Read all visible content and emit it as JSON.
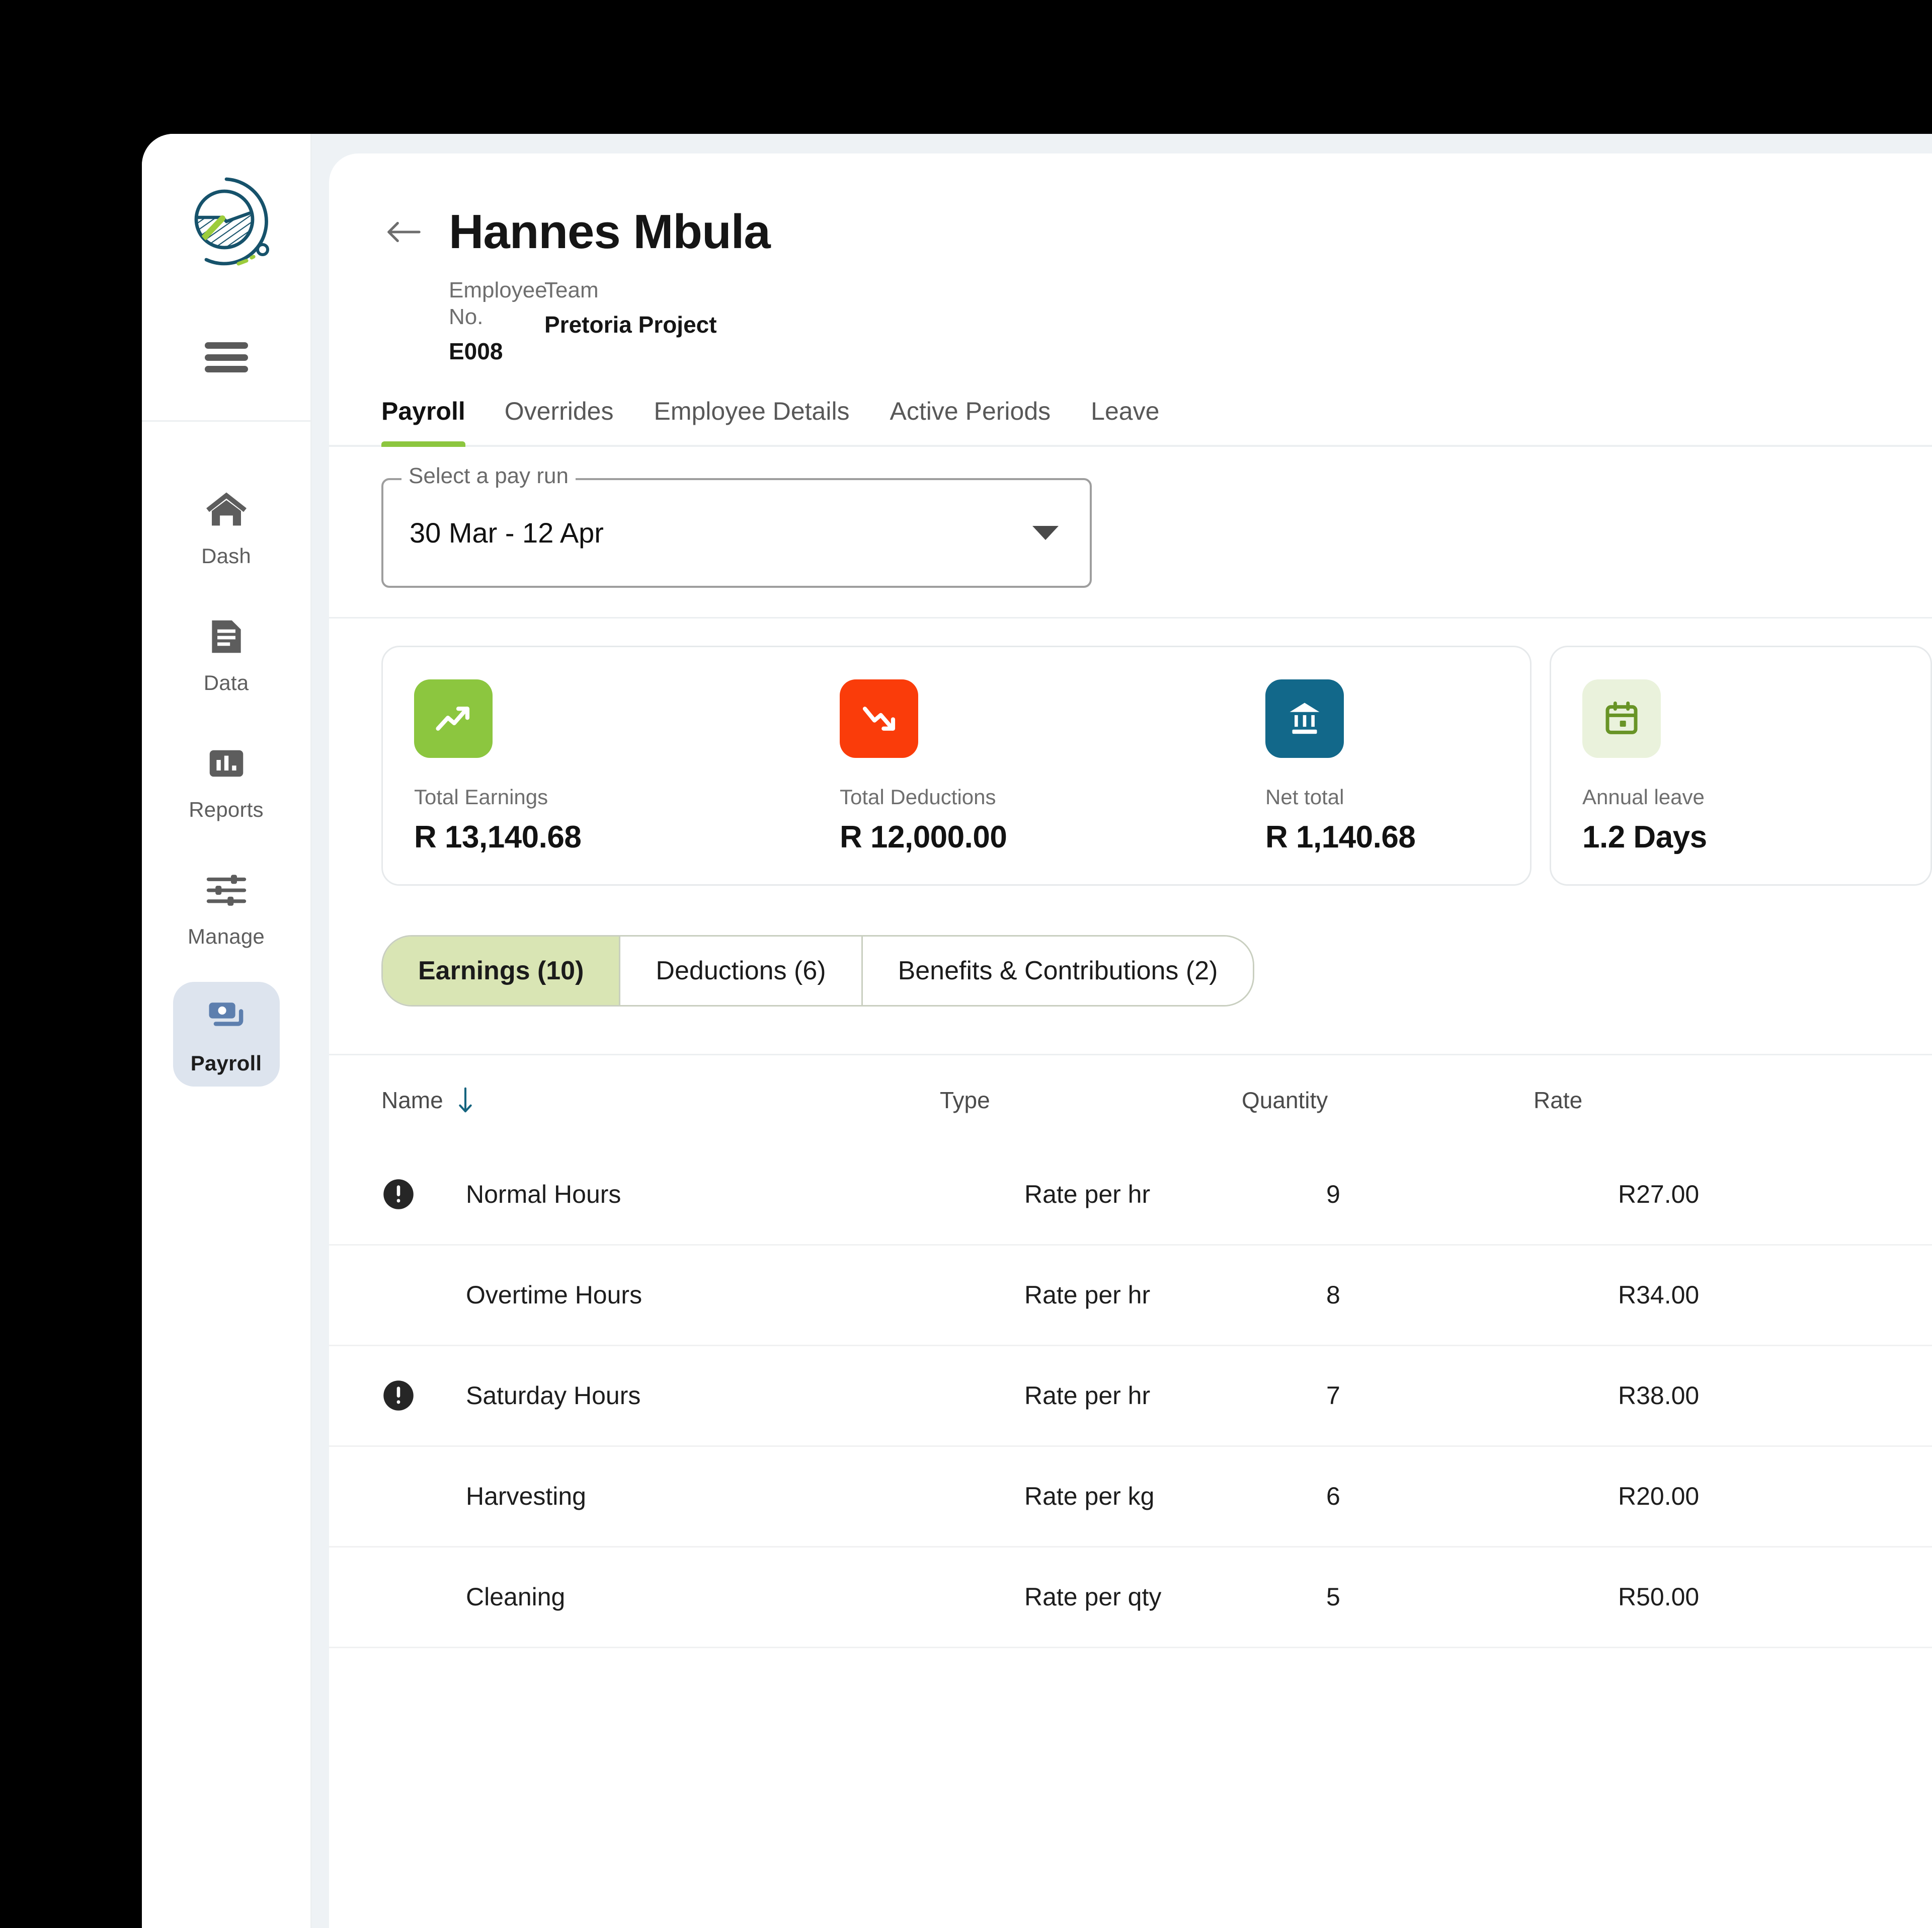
{
  "sidebar": {
    "logo_name": "farm-circle-logo",
    "menu_toggle_name": "hamburger-menu",
    "items": [
      {
        "label": "Dash",
        "icon": "home-icon",
        "active": false
      },
      {
        "label": "Data",
        "icon": "document-icon",
        "active": false
      },
      {
        "label": "Reports",
        "icon": "bar-chart-icon",
        "active": false
      },
      {
        "label": "Manage",
        "icon": "sliders-icon",
        "active": false
      },
      {
        "label": "Payroll",
        "icon": "banknotes-icon",
        "active": true
      }
    ]
  },
  "header": {
    "back_label": "←",
    "title": "Hannes Mbula",
    "meta": [
      {
        "label": "Employee No.",
        "value": "E008"
      },
      {
        "label": "Team",
        "value": "Pretoria Project"
      }
    ]
  },
  "tabs": [
    {
      "label": "Payroll",
      "active": true
    },
    {
      "label": "Overrides",
      "active": false
    },
    {
      "label": "Employee Details",
      "active": false
    },
    {
      "label": "Active Periods",
      "active": false
    },
    {
      "label": "Leave",
      "active": false
    }
  ],
  "payrun": {
    "legend": "Select a pay run",
    "value": "30 Mar - 12 Apr"
  },
  "summary": {
    "stats": [
      {
        "label": "Total Earnings",
        "value": "R 13,140.68",
        "icon": "trend-up-icon",
        "tone": "green"
      },
      {
        "label": "Total Deductions",
        "value": "R 12,000.00",
        "icon": "trend-down-icon",
        "tone": "red"
      },
      {
        "label": "Net total",
        "value": "R 1,140.68",
        "icon": "bank-icon",
        "tone": "teal"
      }
    ],
    "leave": {
      "label": "Annual leave",
      "value": "1.2 Days",
      "icon": "calendar-icon",
      "tone": "lightgreen"
    }
  },
  "segments": [
    {
      "label": "Earnings (10)",
      "active": true
    },
    {
      "label": "Deductions (6)",
      "active": false
    },
    {
      "label": "Benefits & Contributions (2)",
      "active": false
    }
  ],
  "table": {
    "columns": [
      "Name",
      "Type",
      "Quantity",
      "Rate"
    ],
    "sort": {
      "column": "Name",
      "direction": "desc",
      "icon": "arrow-down-icon"
    },
    "rows": [
      {
        "flag": true,
        "name": "Normal Hours",
        "type": "Rate per hr",
        "quantity": "9",
        "rate": "R27.00"
      },
      {
        "flag": false,
        "name": "Overtime Hours",
        "type": "Rate per hr",
        "quantity": "8",
        "rate": "R34.00"
      },
      {
        "flag": true,
        "name": "Saturday Hours",
        "type": "Rate per hr",
        "quantity": "7",
        "rate": "R38.00"
      },
      {
        "flag": false,
        "name": "Harvesting",
        "type": "Rate per kg",
        "quantity": "6",
        "rate": "R20.00"
      },
      {
        "flag": false,
        "name": "Cleaning",
        "type": "Rate per qty",
        "quantity": "5",
        "rate": "R50.00"
      }
    ]
  },
  "colors": {
    "accent_green": "#8cc63f",
    "danger_red": "#fa3c0a",
    "brand_teal": "#12688a",
    "segment_active": "#d9e5b4",
    "sidebar_active": "#dde4ee",
    "page_bg": "#eef2f5"
  }
}
